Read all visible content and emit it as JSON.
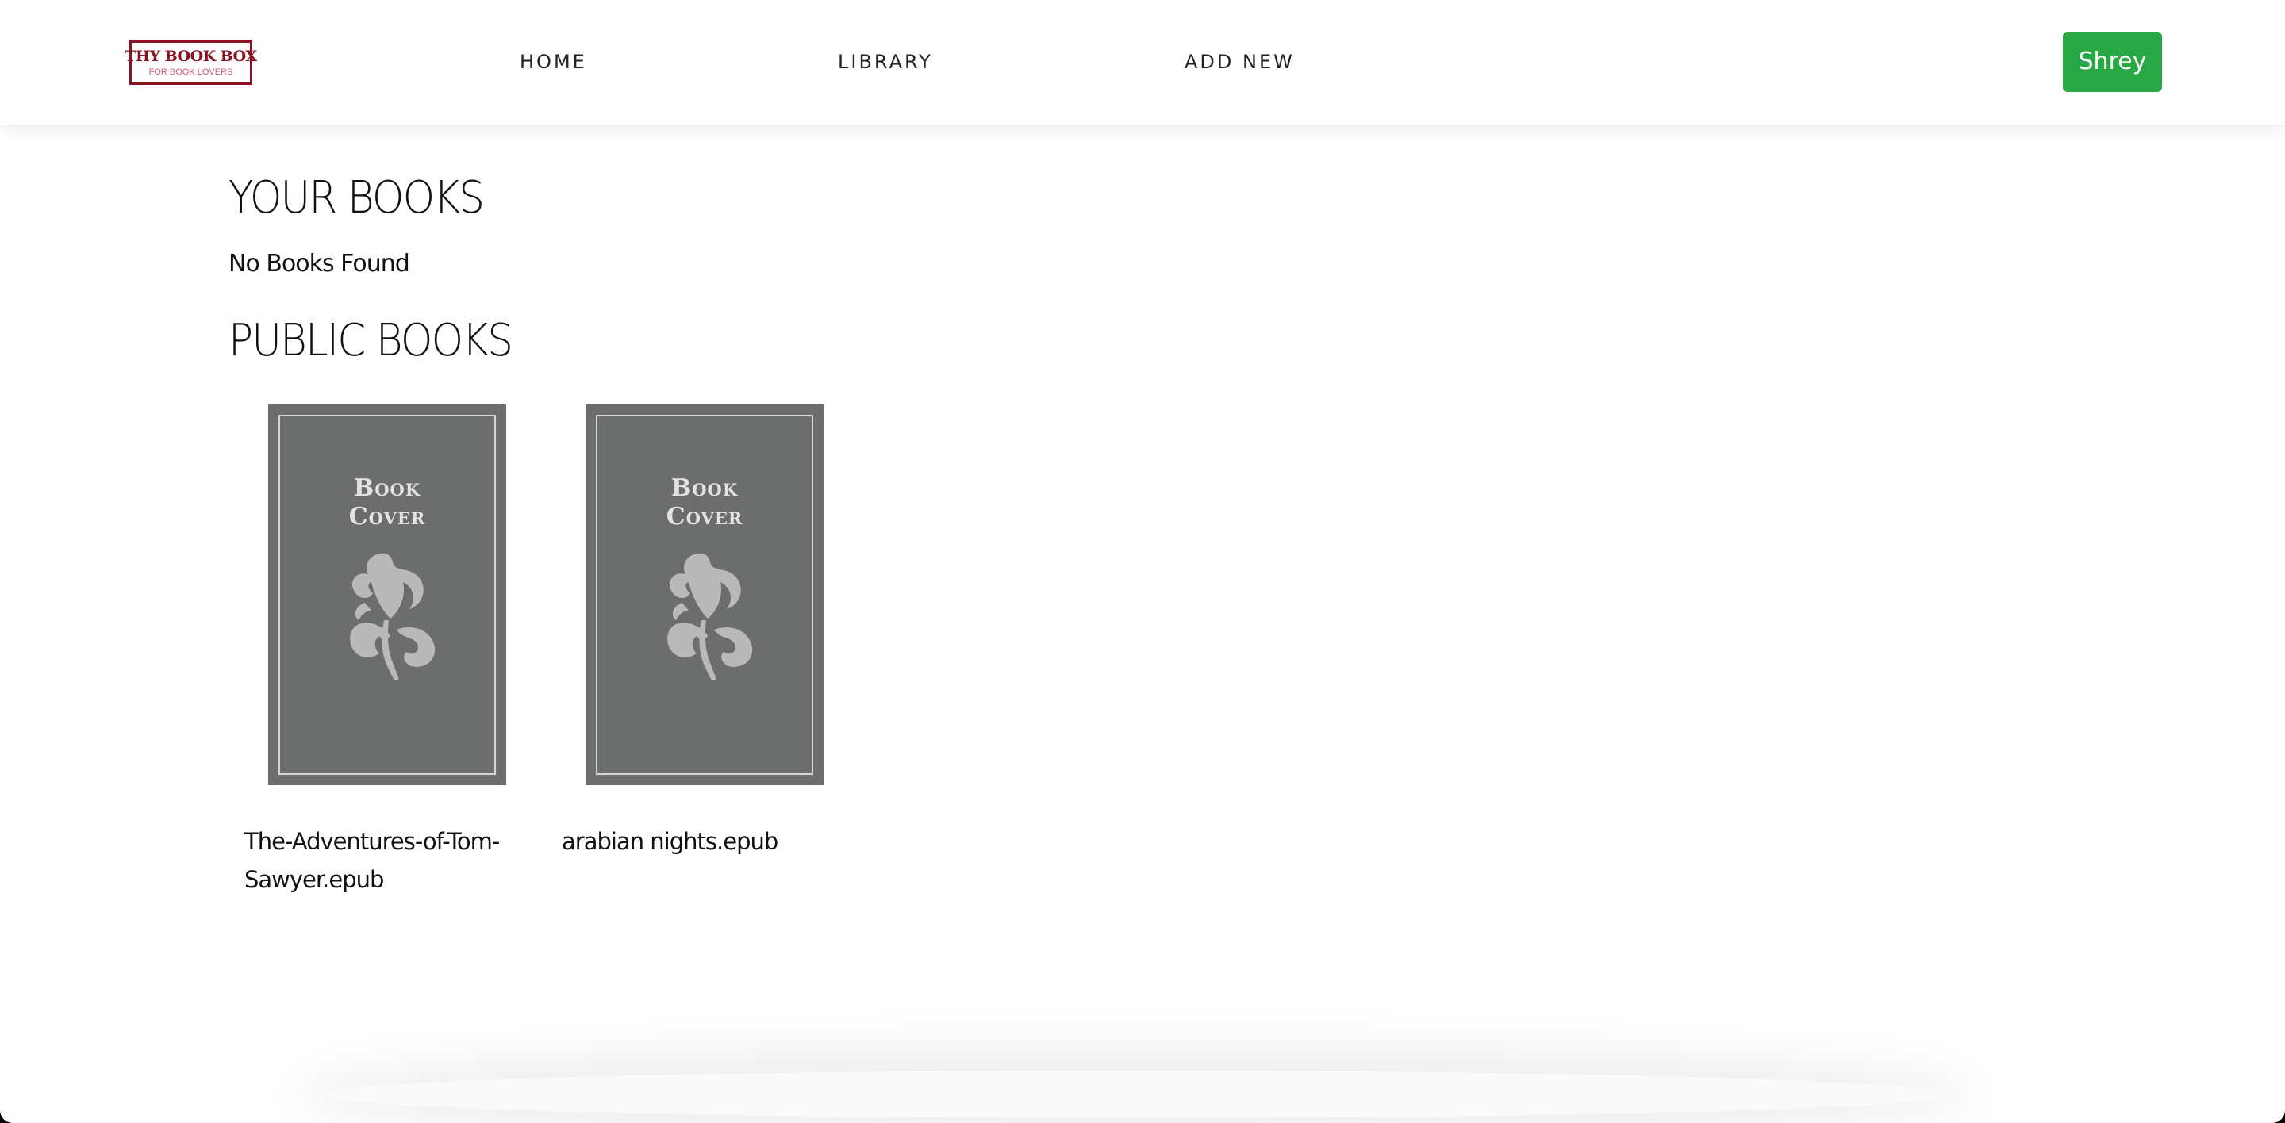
{
  "navbar": {
    "logo": {
      "title": "THY BOOK BOX",
      "subtitle": "FOR BOOK LOVERS",
      "color": "#8a1320"
    },
    "links": [
      {
        "label": "HOME"
      },
      {
        "label": "LIBRARY"
      },
      {
        "label": "ADD NEW"
      }
    ],
    "user_button": {
      "label": "Shrey",
      "color": "#28a745"
    }
  },
  "your_books": {
    "heading": "YOUR BOOKS",
    "empty_message": "No Books Found"
  },
  "public_books": {
    "heading": "PUBLIC BOOKS",
    "items": [
      {
        "cover_text": "Book Cover",
        "cover_line1": "Book",
        "cover_line2": "Cover",
        "title": "The-Adventures-of-Tom-Sawyer.epub"
      },
      {
        "cover_text": "Book Cover",
        "cover_line1": "Book",
        "cover_line2": "Cover",
        "title": "arabian nights.epub"
      }
    ],
    "cover_color": "#6c6e6d"
  },
  "icons": {
    "cover_ornament": "leaf-ornament-icon"
  }
}
